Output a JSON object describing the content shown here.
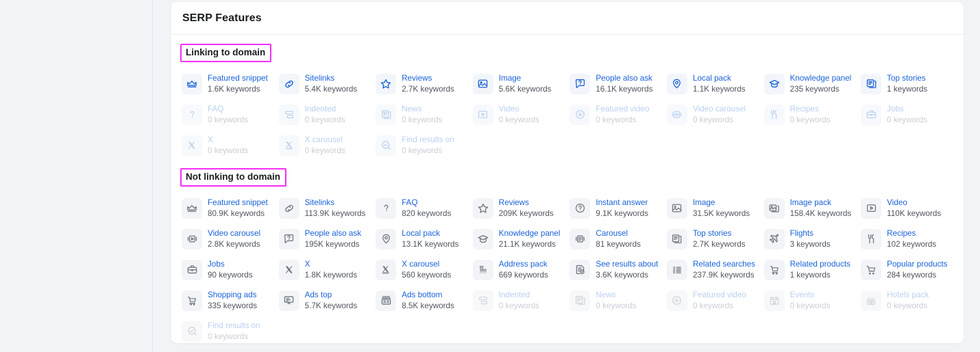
{
  "card": {
    "title": "SERP Features"
  },
  "sections": [
    {
      "id": "linking",
      "heading": "Linking to domain",
      "icon_style": "blue",
      "features": [
        {
          "icon": "featured-snippet-icon",
          "label": "Featured snippet",
          "count": "1.6K keywords",
          "muted": false
        },
        {
          "icon": "sitelinks-icon",
          "label": "Sitelinks",
          "count": "5.4K keywords",
          "muted": false
        },
        {
          "icon": "reviews-icon",
          "label": "Reviews",
          "count": "2.7K keywords",
          "muted": false
        },
        {
          "icon": "image-icon",
          "label": "Image",
          "count": "5.6K keywords",
          "muted": false
        },
        {
          "icon": "people-also-ask-icon",
          "label": "People also ask",
          "count": "16.1K keywords",
          "muted": false
        },
        {
          "icon": "local-pack-icon",
          "label": "Local pack",
          "count": "1.1K keywords",
          "muted": false
        },
        {
          "icon": "knowledge-panel-icon",
          "label": "Knowledge panel",
          "count": "235 keywords",
          "muted": false
        },
        {
          "icon": "top-stories-icon",
          "label": "Top stories",
          "count": "1 keywords",
          "muted": false
        },
        {
          "icon": "faq-icon",
          "label": "FAQ",
          "count": "0 keywords",
          "muted": true
        },
        {
          "icon": "indented-icon",
          "label": "Indented",
          "count": "0 keywords",
          "muted": true
        },
        {
          "icon": "news-icon",
          "label": "News",
          "count": "0 keywords",
          "muted": true
        },
        {
          "icon": "video-icon",
          "label": "Video",
          "count": "0 keywords",
          "muted": true
        },
        {
          "icon": "featured-video-icon",
          "label": "Featured video",
          "count": "0 keywords",
          "muted": true
        },
        {
          "icon": "video-carousel-icon",
          "label": "Video carousel",
          "count": "0 keywords",
          "muted": true
        },
        {
          "icon": "recipes-icon",
          "label": "Recipes",
          "count": "0 keywords",
          "muted": true
        },
        {
          "icon": "jobs-icon",
          "label": "Jobs",
          "count": "0 keywords",
          "muted": true
        },
        {
          "icon": "x-icon",
          "label": "X",
          "count": "0 keywords",
          "muted": true
        },
        {
          "icon": "x-carousel-icon",
          "label": "X carousel",
          "count": "0 keywords",
          "muted": true
        },
        {
          "icon": "find-results-on-icon",
          "label": "Find results on",
          "count": "0 keywords",
          "muted": true
        }
      ]
    },
    {
      "id": "not-linking",
      "heading": "Not linking to domain",
      "icon_style": "gray",
      "features": [
        {
          "icon": "featured-snippet-icon",
          "label": "Featured snippet",
          "count": "80.9K keywords",
          "muted": false
        },
        {
          "icon": "sitelinks-icon",
          "label": "Sitelinks",
          "count": "113.9K keywords",
          "muted": false
        },
        {
          "icon": "faq-icon",
          "label": "FAQ",
          "count": "820 keywords",
          "muted": false
        },
        {
          "icon": "reviews-icon",
          "label": "Reviews",
          "count": "209K keywords",
          "muted": false
        },
        {
          "icon": "instant-answer-icon",
          "label": "Instant answer",
          "count": "9.1K keywords",
          "muted": false
        },
        {
          "icon": "image-icon",
          "label": "Image",
          "count": "31.5K keywords",
          "muted": false
        },
        {
          "icon": "image-pack-icon",
          "label": "Image pack",
          "count": "158.4K keywords",
          "muted": false
        },
        {
          "icon": "video-icon",
          "label": "Video",
          "count": "110K keywords",
          "muted": false
        },
        {
          "icon": "video-carousel-icon",
          "label": "Video carousel",
          "count": "2.8K keywords",
          "muted": false
        },
        {
          "icon": "people-also-ask-icon",
          "label": "People also ask",
          "count": "195K keywords",
          "muted": false
        },
        {
          "icon": "local-pack-icon",
          "label": "Local pack",
          "count": "13.1K keywords",
          "muted": false
        },
        {
          "icon": "knowledge-panel-icon",
          "label": "Knowledge panel",
          "count": "21.1K keywords",
          "muted": false
        },
        {
          "icon": "carousel-icon",
          "label": "Carousel",
          "count": "81 keywords",
          "muted": false
        },
        {
          "icon": "top-stories-icon",
          "label": "Top stories",
          "count": "2.7K keywords",
          "muted": false
        },
        {
          "icon": "flights-icon",
          "label": "Flights",
          "count": "3 keywords",
          "muted": false
        },
        {
          "icon": "recipes-icon",
          "label": "Recipes",
          "count": "102 keywords",
          "muted": false
        },
        {
          "icon": "jobs-icon",
          "label": "Jobs",
          "count": "90 keywords",
          "muted": false
        },
        {
          "icon": "x-icon",
          "label": "X",
          "count": "1.8K keywords",
          "muted": false
        },
        {
          "icon": "x-carousel-icon",
          "label": "X carousel",
          "count": "560 keywords",
          "muted": false
        },
        {
          "icon": "address-pack-icon",
          "label": "Address pack",
          "count": "669 keywords",
          "muted": false
        },
        {
          "icon": "see-results-about-icon",
          "label": "See results about",
          "count": "3.6K keywords",
          "muted": false
        },
        {
          "icon": "related-searches-icon",
          "label": "Related searches",
          "count": "237.9K keywords",
          "muted": false
        },
        {
          "icon": "related-products-icon",
          "label": "Related products",
          "count": "1 keywords",
          "muted": false
        },
        {
          "icon": "popular-products-icon",
          "label": "Popular products",
          "count": "284 keywords",
          "muted": false
        },
        {
          "icon": "shopping-ads-icon",
          "label": "Shopping ads",
          "count": "335 keywords",
          "muted": false
        },
        {
          "icon": "ads-top-icon",
          "label": "Ads top",
          "count": "5.7K keywords",
          "muted": false
        },
        {
          "icon": "ads-bottom-icon",
          "label": "Ads bottom",
          "count": "8.5K keywords",
          "muted": false
        },
        {
          "icon": "indented-icon",
          "label": "Indented",
          "count": "0 keywords",
          "muted": true
        },
        {
          "icon": "news-icon",
          "label": "News",
          "count": "0 keywords",
          "muted": true
        },
        {
          "icon": "featured-video-icon",
          "label": "Featured video",
          "count": "0 keywords",
          "muted": true
        },
        {
          "icon": "events-icon",
          "label": "Events",
          "count": "0 keywords",
          "muted": true
        },
        {
          "icon": "hotels-pack-icon",
          "label": "Hotels pack",
          "count": "0 keywords",
          "muted": true
        },
        {
          "icon": "find-results-on-icon",
          "label": "Find results on",
          "count": "0 keywords",
          "muted": true
        }
      ]
    }
  ],
  "colors": {
    "link": "#1a62d6",
    "annotation": "#f52ff5",
    "page_bg": "#f2f3f7",
    "card_bg": "#ffffff"
  }
}
